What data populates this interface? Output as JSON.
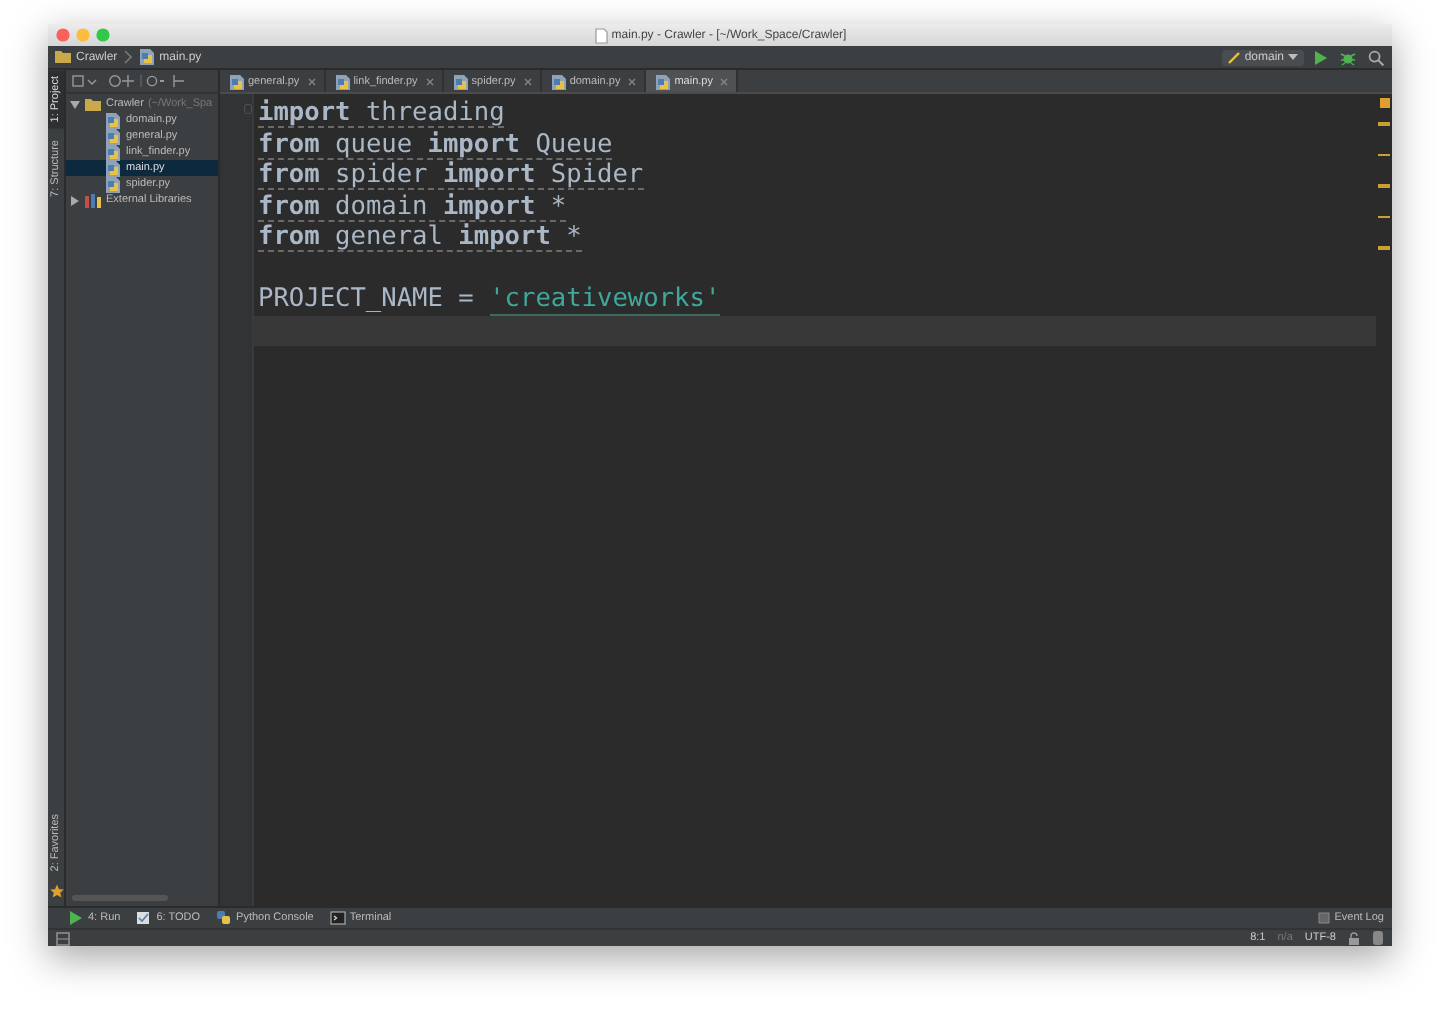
{
  "window": {
    "title": "main.py - Crawler - [~/Work_Space/Crawler]"
  },
  "navbar": {
    "breadcrumbs": [
      "Crawler",
      "main.py"
    ],
    "run_config": "domain"
  },
  "tool_strip": {
    "top": [
      {
        "label": "1: Project",
        "selected": true
      },
      {
        "label": "7: Structure",
        "selected": false
      }
    ],
    "bottom": [
      {
        "label": "2: Favorites",
        "selected": false
      }
    ]
  },
  "tabs": [
    {
      "label": "general.py",
      "selected": false
    },
    {
      "label": "link_finder.py",
      "selected": false
    },
    {
      "label": "spider.py",
      "selected": false
    },
    {
      "label": "domain.py",
      "selected": false
    },
    {
      "label": "main.py",
      "selected": true
    }
  ],
  "project_tree": [
    {
      "label": "Crawler",
      "path": "(~/Work_Spa",
      "kind": "folder",
      "expanded": true,
      "selected": false,
      "children": [
        {
          "label": "domain.py",
          "kind": "file",
          "selected": false
        },
        {
          "label": "general.py",
          "kind": "file",
          "selected": false
        },
        {
          "label": "link_finder.py",
          "kind": "file",
          "selected": false
        },
        {
          "label": "main.py",
          "kind": "file",
          "selected": true
        },
        {
          "label": "spider.py",
          "kind": "file",
          "selected": false
        }
      ]
    },
    {
      "label": "External Libraries",
      "kind": "library",
      "expanded": false,
      "selected": false
    }
  ],
  "editor": {
    "lines": [
      {
        "kind": "code",
        "warning": true,
        "current": false,
        "tokens": [
          {
            "kind": "keyword",
            "text": "import"
          },
          {
            "kind": "plain",
            "text": " threading"
          }
        ]
      },
      {
        "kind": "code",
        "warning": true,
        "current": false,
        "tokens": [
          {
            "kind": "keyword",
            "text": "from"
          },
          {
            "kind": "plain",
            "text": " queue "
          },
          {
            "kind": "keyword",
            "text": "import"
          },
          {
            "kind": "plain",
            "text": " Queue"
          }
        ]
      },
      {
        "kind": "code",
        "warning": true,
        "current": false,
        "tokens": [
          {
            "kind": "keyword",
            "text": "from"
          },
          {
            "kind": "plain",
            "text": " spider "
          },
          {
            "kind": "keyword",
            "text": "import"
          },
          {
            "kind": "plain",
            "text": " Spider"
          }
        ]
      },
      {
        "kind": "code",
        "warning": true,
        "current": false,
        "tokens": [
          {
            "kind": "keyword",
            "text": "from"
          },
          {
            "kind": "plain",
            "text": " domain "
          },
          {
            "kind": "keyword",
            "text": "import"
          },
          {
            "kind": "plain",
            "text": " *"
          }
        ]
      },
      {
        "kind": "code",
        "warning": true,
        "current": false,
        "tokens": [
          {
            "kind": "keyword",
            "text": "from"
          },
          {
            "kind": "plain",
            "text": " general "
          },
          {
            "kind": "keyword",
            "text": "import"
          },
          {
            "kind": "plain",
            "text": " *"
          }
        ]
      },
      {
        "kind": "blank",
        "current": false
      },
      {
        "kind": "code",
        "warning": false,
        "current": false,
        "tokens": [
          {
            "kind": "plain",
            "text": "PROJECT_NAME = "
          },
          {
            "kind": "string",
            "text": "'creativeworks'"
          }
        ]
      },
      {
        "kind": "blank",
        "current": true
      }
    ]
  },
  "bottom_tools": [
    "4: Run",
    "6: TODO",
    "Python Console",
    "Terminal"
  ],
  "event_log": "Event Log",
  "status_bar": {
    "position": "8:1",
    "na": "n/a",
    "encoding": "UTF-8"
  }
}
